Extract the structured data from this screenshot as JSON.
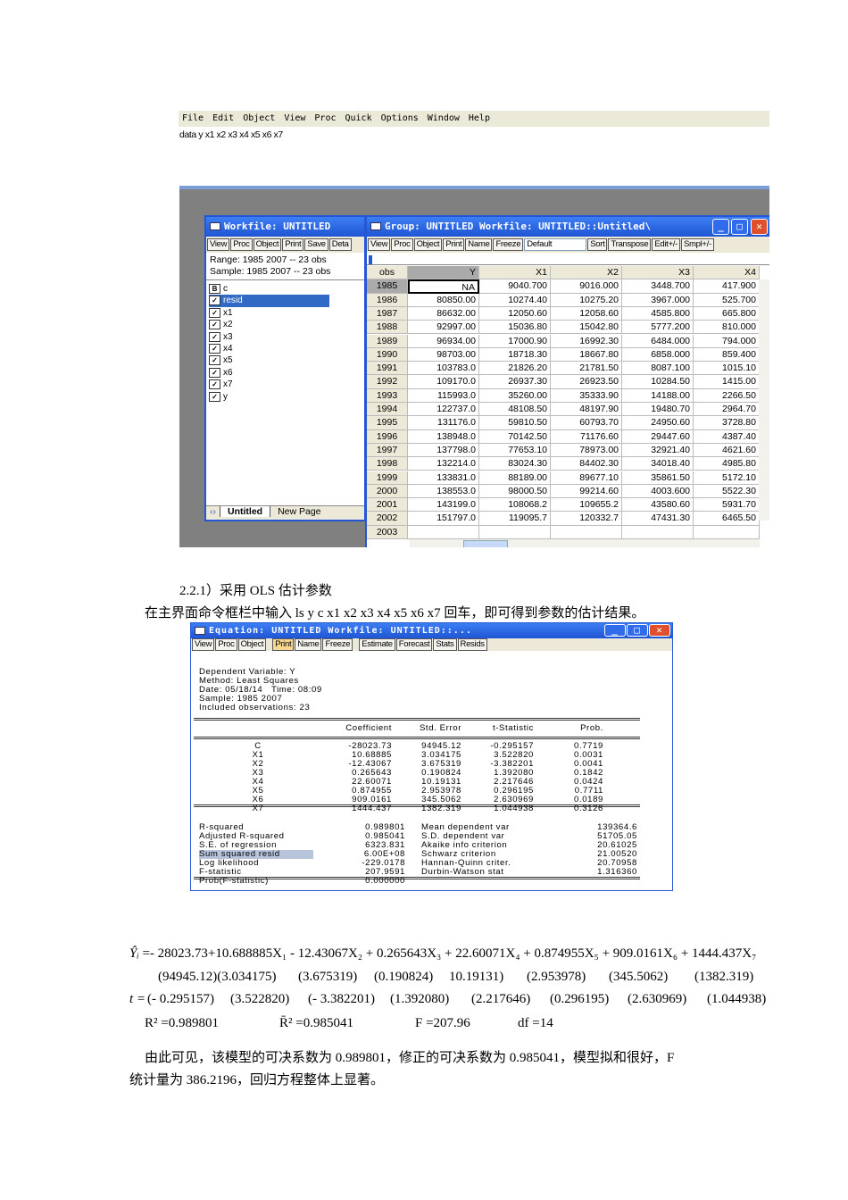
{
  "menu": [
    "File",
    "Edit",
    "Object",
    "View",
    "Proc",
    "Quick",
    "Options",
    "Window",
    "Help"
  ],
  "command": "data y x1 x2 x3 x4 x5 x6 x7",
  "workfile": {
    "title": "Workfile: UNTITLED",
    "toolbar": [
      "View",
      "Proc",
      "Object",
      "Print",
      "Save",
      "Deta"
    ],
    "range": "Range:  1985 2007  --  23 obs",
    "sample": "Sample: 1985 2007  --  23 obs",
    "objects": [
      {
        "icon": "B",
        "name": "c"
      },
      {
        "icon": "✓",
        "name": "resid"
      },
      {
        "icon": "✓",
        "name": "x1"
      },
      {
        "icon": "✓",
        "name": "x2"
      },
      {
        "icon": "✓",
        "name": "x3"
      },
      {
        "icon": "✓",
        "name": "x4"
      },
      {
        "icon": "✓",
        "name": "x5"
      },
      {
        "icon": "✓",
        "name": "x6"
      },
      {
        "icon": "✓",
        "name": "x7"
      },
      {
        "icon": "✓",
        "name": "y"
      }
    ],
    "selected": "resid",
    "tabs": [
      "Untitled",
      "New Page"
    ]
  },
  "group": {
    "title": "Group: UNTITLED    Workfile: UNTITLED::Untitled\\",
    "toolbar": [
      "View",
      "Proc",
      "Object",
      "Print",
      "Name",
      "Freeze"
    ],
    "format": "Default",
    "toolbar2": [
      "Sort",
      "Transpose",
      "Edit+/-",
      "Smpl+/-"
    ],
    "columns": [
      "obs",
      "Y",
      "X1",
      "X2",
      "X3",
      "X4"
    ],
    "rows": [
      [
        "1985",
        "NA",
        "9040.700",
        "9016.000",
        "3448.700",
        "417.900"
      ],
      [
        "1986",
        "80850.00",
        "10274.40",
        "10275.20",
        "3967.000",
        "525.700"
      ],
      [
        "1987",
        "86632.00",
        "12050.60",
        "12058.60",
        "4585.800",
        "665.800"
      ],
      [
        "1988",
        "92997.00",
        "15036.80",
        "15042.80",
        "5777.200",
        "810.000"
      ],
      [
        "1989",
        "96934.00",
        "17000.90",
        "16992.30",
        "6484.000",
        "794.000"
      ],
      [
        "1990",
        "98703.00",
        "18718.30",
        "18667.80",
        "6858.000",
        "859.400"
      ],
      [
        "1991",
        "103783.0",
        "21826.20",
        "21781.50",
        "8087.100",
        "1015.10"
      ],
      [
        "1992",
        "109170.0",
        "26937.30",
        "26923.50",
        "10284.50",
        "1415.00"
      ],
      [
        "1993",
        "115993.0",
        "35260.00",
        "35333.90",
        "14188.00",
        "2266.50"
      ],
      [
        "1994",
        "122737.0",
        "48108.50",
        "48197.90",
        "19480.70",
        "2964.70"
      ],
      [
        "1995",
        "131176.0",
        "59810.50",
        "60793.70",
        "24950.60",
        "3728.80"
      ],
      [
        "1996",
        "138948.0",
        "70142.50",
        "71176.60",
        "29447.60",
        "4387.40"
      ],
      [
        "1997",
        "137798.0",
        "77653.10",
        "78973.00",
        "32921.40",
        "4621.60"
      ],
      [
        "1998",
        "132214.0",
        "83024.30",
        "84402.30",
        "34018.40",
        "4985.80"
      ],
      [
        "1999",
        "133831.0",
        "88189.00",
        "89677.10",
        "35861.50",
        "5172.10"
      ],
      [
        "2000",
        "138553.0",
        "98000.50",
        "99214.60",
        "4003.600",
        "5522.30"
      ],
      [
        "2001",
        "143199.0",
        "108068.2",
        "109655.2",
        "43580.60",
        "5931.70"
      ],
      [
        "2002",
        "151797.0",
        "119095.7",
        "120332.7",
        "47431.30",
        "6465.50"
      ],
      [
        "2003",
        "",
        "",
        "",
        "",
        ""
      ]
    ]
  },
  "heading": "2.2.1）采用 OLS 估计参数",
  "intro": "在主界面命令框栏中输入 ls y c x1 x2 x3 x4 x5 x6 x7 回车，即可得到参数的估计结果。",
  "equation": {
    "title": "Equation: UNTITLED    Workfile: UNTITLED::...",
    "toolbar": [
      "View",
      "Proc",
      "Object",
      "Print",
      "Name",
      "Freeze",
      "Estimate",
      "Forecast",
      "Stats",
      "Resids"
    ],
    "header": [
      "Dependent Variable: Y",
      "Method: Least Squares",
      "Date: 05/18/14   Time: 08:09",
      "Sample: 1985 2007",
      "Included observations: 23"
    ],
    "columns": [
      "Coefficient",
      "Std. Error",
      "t-Statistic",
      "Prob."
    ],
    "coefs": [
      [
        "C",
        "-28023.73",
        "94945.12",
        "-0.295157",
        "0.7719"
      ],
      [
        "X1",
        "10.68885",
        "3.034175",
        "3.522820",
        "0.0031"
      ],
      [
        "X2",
        "-12.43067",
        "3.675319",
        "-3.382201",
        "0.0041"
      ],
      [
        "X3",
        "0.265643",
        "0.190824",
        "1.392080",
        "0.1842"
      ],
      [
        "X4",
        "22.60071",
        "10.19131",
        "2.217646",
        "0.0424"
      ],
      [
        "X5",
        "0.874955",
        "2.953978",
        "0.296195",
        "0.7711"
      ],
      [
        "X6",
        "909.0161",
        "345.5062",
        "2.630969",
        "0.0189"
      ],
      [
        "X7",
        "1444.437",
        "1382.319",
        "1.044938",
        "0.3126"
      ]
    ],
    "stats": [
      [
        "R-squared",
        "0.989801",
        "Mean dependent var",
        "139364.6"
      ],
      [
        "Adjusted R-squared",
        "0.985041",
        "S.D. dependent var",
        "51705.05"
      ],
      [
        "S.E. of regression",
        "6323.831",
        "Akaike info criterion",
        "20.61025"
      ],
      [
        "Sum squared resid",
        "6.00E+08",
        "Schwarz criterion",
        "21.00520"
      ],
      [
        "Log likelihood",
        "-229.0178",
        "Hannan-Quinn criter.",
        "20.70958"
      ],
      [
        "F-statistic",
        "207.9591",
        "Durbin-Watson stat",
        "1.316360"
      ],
      [
        "Prob(F-statistic)",
        "0.000000",
        "",
        ""
      ]
    ]
  },
  "formula": {
    "line1": "=- 28023.73+10.688885X₁ - 12.43067X₂ + 0.265643X₃ + 22.60071X₄ + 0.874955X₅ + 909.0161X₆ + 1444.437X₇",
    "lhs": "Ŷᵢ",
    "se": [
      "(94945.12)(3.034175)",
      "(3.675319)",
      "(0.190824)",
      "10.19131)",
      "(2.953978)",
      "(345.5062)",
      "(1382.319)"
    ],
    "t_label": "t =",
    "t": [
      "(- 0.295157)",
      "(3.522820)",
      "(- 3.382201)",
      "(1.392080)",
      "(2.217646)",
      "(0.296195)",
      "(2.630969)",
      "(1.044938)"
    ],
    "r2": "R² =0.989801",
    "adj_r2": "R̄² =0.985041",
    "f": "F =207.96",
    "df": "df =14"
  },
  "conclusion": [
    "由此可见，该模型的可决系数为 0.989801，修正的可决系数为 0.985041，模型拟和很好，F",
    "统计量为 386.2196，回归方程整体上显著。"
  ]
}
